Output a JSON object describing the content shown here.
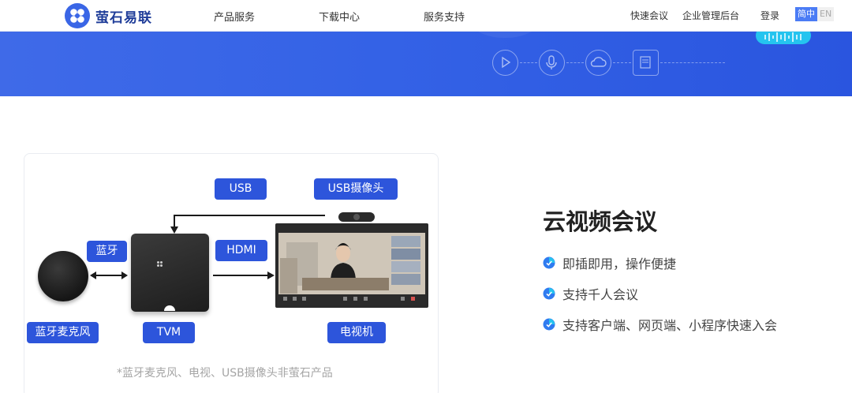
{
  "header": {
    "logo_text": "萤石易联",
    "nav": [
      "产品服务",
      "下载中心",
      "服务支持"
    ],
    "right": [
      "快速会议",
      "企业管理后台",
      "登录"
    ],
    "lang_active": "简中",
    "lang_inactive": "EN"
  },
  "diagram": {
    "tags": {
      "usb": "USB",
      "usb_camera": "USB摄像头",
      "bluetooth": "蓝牙",
      "hdmi": "HDMI",
      "bt_mic": "蓝牙麦克风",
      "tvm": "TVM",
      "tv": "电视机"
    },
    "note": "*蓝牙麦克风、电视、USB摄像头非萤石产品"
  },
  "feature": {
    "title": "云视频会议",
    "items": [
      "即插即用，操作便捷",
      "支持千人会议",
      "支持客户端、网页端、小程序快速入会"
    ]
  },
  "colors": {
    "accent": "#2d55db",
    "banner": "#3462e6",
    "icon_blue": "#2f7bf0",
    "icon_cyan": "#25c4ef"
  }
}
